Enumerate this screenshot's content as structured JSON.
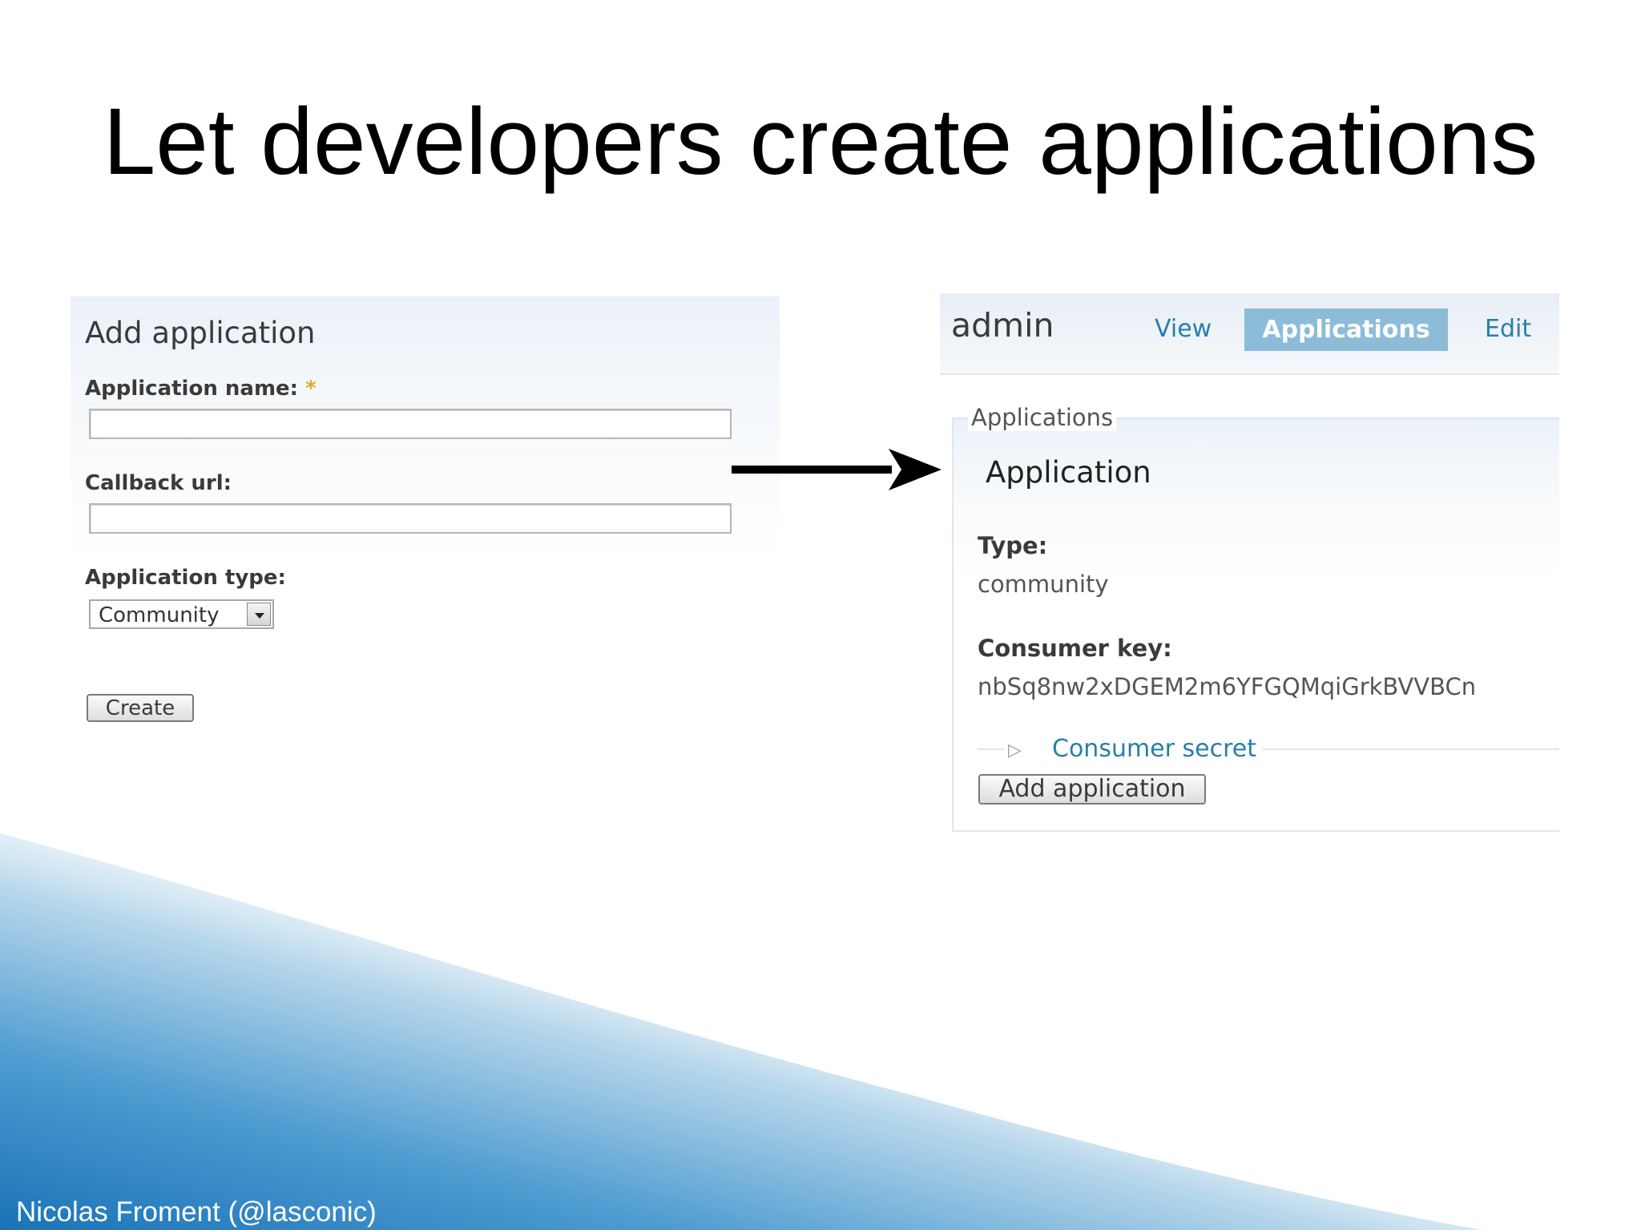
{
  "slide": {
    "title": "Let developers create applications",
    "footer": "Nicolas Froment (@lasconic)"
  },
  "add_form": {
    "heading": "Add application",
    "name_label": "Application name:",
    "required_marker": "*",
    "name_value": "",
    "callback_label": "Callback url:",
    "callback_value": "",
    "type_label": "Application type:",
    "type_selected": "Community",
    "create_label": "Create"
  },
  "admin_view": {
    "user": "admin",
    "tabs": [
      {
        "label": "View",
        "active": false
      },
      {
        "label": "Applications",
        "active": true
      },
      {
        "label": "Edit",
        "active": false
      }
    ],
    "fieldset_legend": "Applications",
    "app_title": "Application",
    "type_label": "Type:",
    "type_value": "community",
    "key_label": "Consumer key:",
    "key_value": "nbSq8nw2xDGEM2m6YFGQMqiGrkBVVBCn",
    "secret_label": "Consumer secret",
    "add_button_label": "Add application"
  },
  "colors": {
    "link": "#2a7ea8",
    "active_tab": "#8dbcd9",
    "wave_dark": "#1a73b8"
  },
  "icons": {
    "flow_arrow": "arrow-right-icon",
    "select_dropdown": "chevron-down-icon",
    "collapse": "triangle-right-icon"
  }
}
